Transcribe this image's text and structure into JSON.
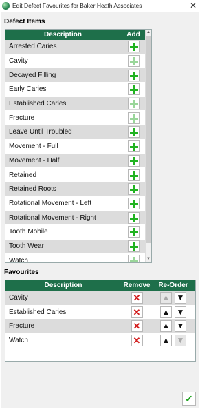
{
  "window": {
    "title": "Edit Defect Favourites for Baker Heath Associates",
    "close_symbol": "✕"
  },
  "defects": {
    "section_title": "Defect Items",
    "headers": {
      "description": "Description",
      "add": "Add"
    },
    "rows": [
      {
        "label": "Arrested Caries",
        "add_enabled": true
      },
      {
        "label": "Cavity",
        "add_enabled": false
      },
      {
        "label": "Decayed Filling",
        "add_enabled": true
      },
      {
        "label": "Early Caries",
        "add_enabled": true
      },
      {
        "label": "Established Caries",
        "add_enabled": false
      },
      {
        "label": "Fracture",
        "add_enabled": false
      },
      {
        "label": "Leave Until Troubled",
        "add_enabled": true
      },
      {
        "label": "Movement - Full",
        "add_enabled": true
      },
      {
        "label": "Movement - Half",
        "add_enabled": true
      },
      {
        "label": "Retained",
        "add_enabled": true
      },
      {
        "label": "Retained Roots",
        "add_enabled": true
      },
      {
        "label": "Rotational Movement - Left",
        "add_enabled": true
      },
      {
        "label": "Rotational Movement - Right",
        "add_enabled": true
      },
      {
        "label": "Tooth Mobile",
        "add_enabled": true
      },
      {
        "label": "Tooth Wear",
        "add_enabled": true
      },
      {
        "label": "Watch",
        "add_enabled": false
      }
    ]
  },
  "favourites": {
    "section_title": "Favourites",
    "headers": {
      "description": "Description",
      "remove": "Remove",
      "reorder": "Re-Order"
    },
    "rows": [
      {
        "label": "Cavity",
        "up_enabled": false,
        "down_enabled": true
      },
      {
        "label": "Established Caries",
        "up_enabled": true,
        "down_enabled": true
      },
      {
        "label": "Fracture",
        "up_enabled": true,
        "down_enabled": true
      },
      {
        "label": "Watch",
        "up_enabled": true,
        "down_enabled": false
      }
    ]
  },
  "ok_button": {
    "symbol": "✓"
  },
  "colors": {
    "header_green": "#1e6f4a",
    "add_green": "#21b321",
    "remove_red": "#d21a1a"
  }
}
